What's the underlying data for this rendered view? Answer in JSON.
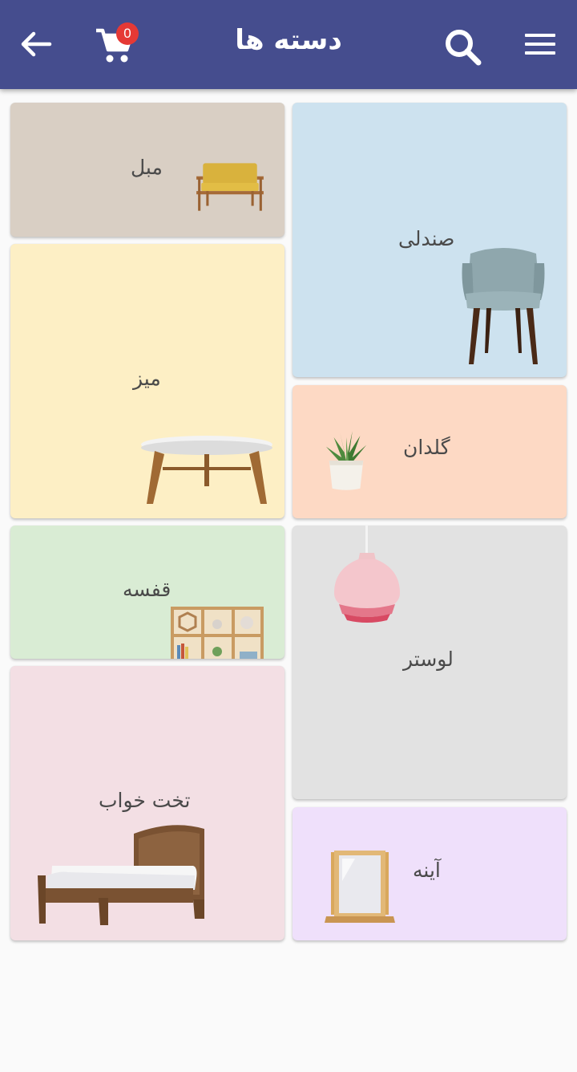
{
  "appbar": {
    "title": "دسته ها",
    "cart_count": "0",
    "colors": {
      "background": "#454d8e",
      "badge": "#e53935"
    }
  },
  "categories": {
    "sofa": {
      "label": "مبل",
      "color": "#d9cfc4",
      "icon": "sofa-icon"
    },
    "chair": {
      "label": "صندلی",
      "color": "#cde2ef",
      "icon": "chair-icon"
    },
    "table": {
      "label": "میز",
      "color": "#fdefc5",
      "icon": "table-icon"
    },
    "vase": {
      "label": "گلدان",
      "color": "#fdd9c4",
      "icon": "plant-pot-icon"
    },
    "shelf": {
      "label": "قفسه",
      "color": "#d9ecd4",
      "icon": "shelf-icon"
    },
    "chandelier": {
      "label": "لوستر",
      "color": "#e2e2e2",
      "icon": "pendant-lamp-icon"
    },
    "bed": {
      "label": "تخت خواب",
      "color": "#f3dfe4",
      "icon": "bed-icon"
    },
    "mirror": {
      "label": "آینه",
      "color": "#efe0fb",
      "icon": "mirror-icon"
    }
  }
}
